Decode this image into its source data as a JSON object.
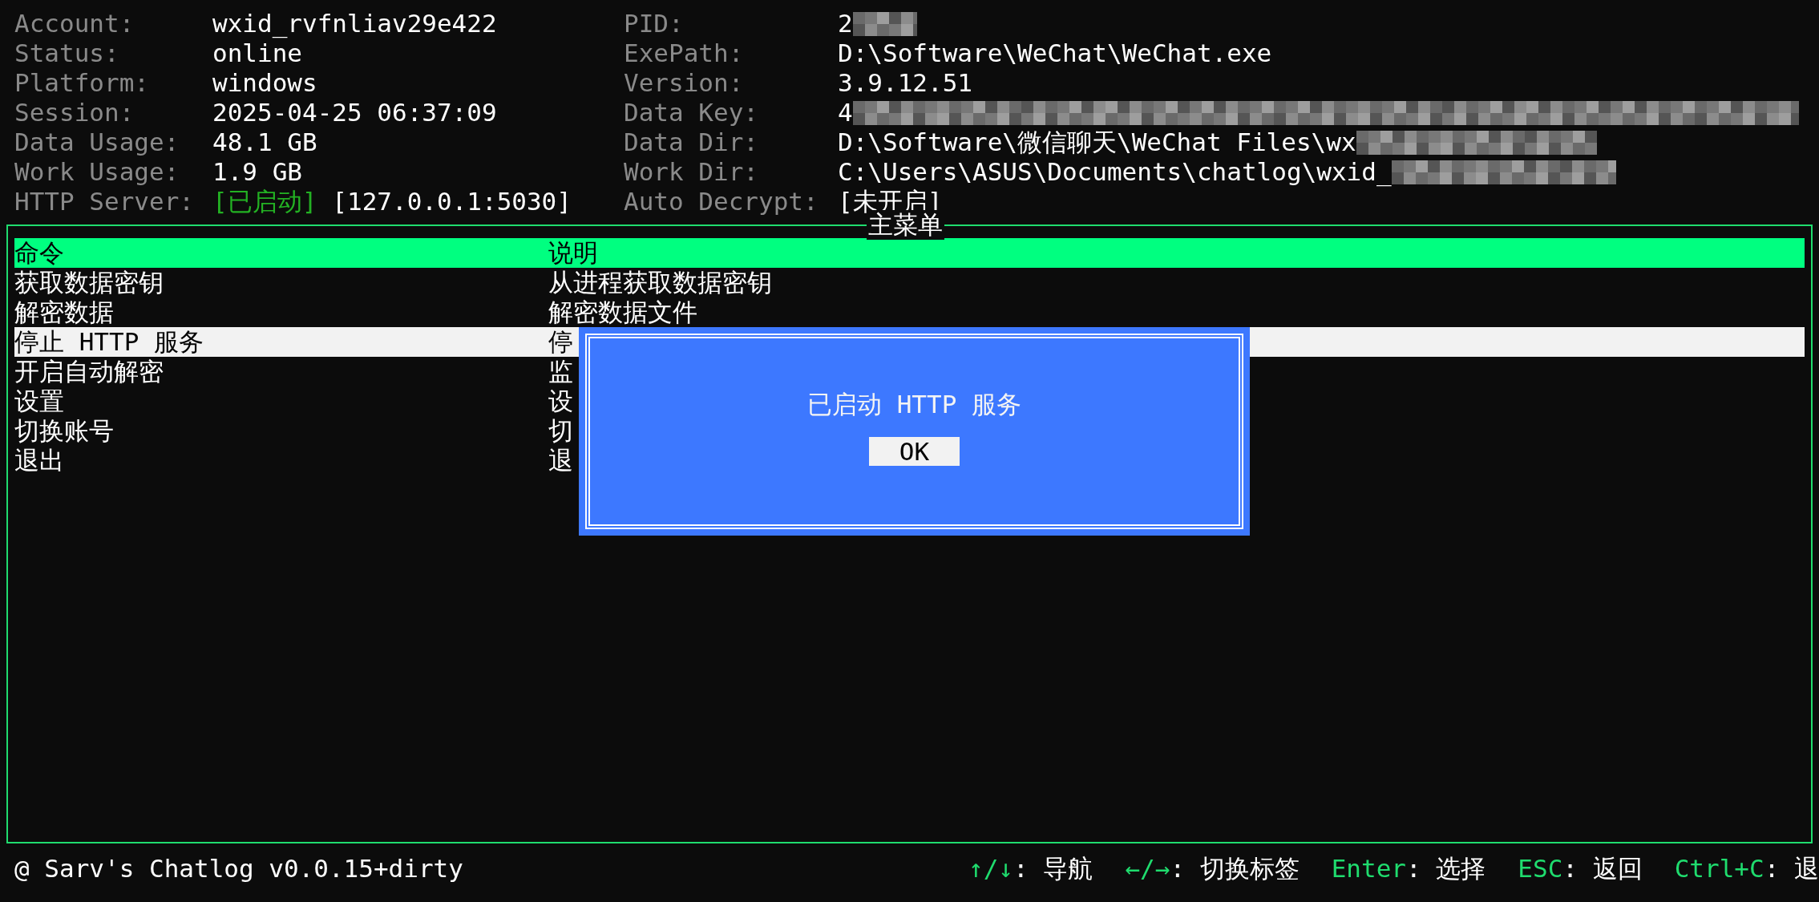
{
  "info_left": [
    {
      "label": "Account:",
      "value": "wxid_rvfnliav29e422"
    },
    {
      "label": "Status:",
      "value": "online"
    },
    {
      "label": "Platform:",
      "value": "windows"
    },
    {
      "label": "Session:",
      "value": "2025-04-25 06:37:09"
    },
    {
      "label": "Data Usage:",
      "value": "48.1 GB"
    },
    {
      "label": "Work Usage:",
      "value": "1.9 GB"
    },
    {
      "label": "HTTP Server:",
      "status": "[已启动]",
      "value": "[127.0.0.1:5030]"
    }
  ],
  "info_right": [
    {
      "label": "PID:",
      "value": "2",
      "redacted": true
    },
    {
      "label": "ExePath:",
      "value": "D:\\Software\\WeChat\\WeChat.exe"
    },
    {
      "label": "Version:",
      "value": "3.9.12.51"
    },
    {
      "label": "Data Key:",
      "value": "4",
      "redacted": true
    },
    {
      "label": "Data Dir:",
      "value": "D:\\Software\\微信聊天\\WeChat Files\\wx",
      "redacted": true
    },
    {
      "label": "Work Dir:",
      "value": "C:\\Users\\ASUS\\Documents\\chatlog\\wxid_",
      "redacted": true
    },
    {
      "label": "Auto Decrypt:",
      "value": "[未开启]"
    }
  ],
  "menu": {
    "title": "主菜单",
    "columns": [
      "命令",
      "说明"
    ],
    "rows": [
      {
        "command": "获取数据密钥",
        "description": "从进程获取数据密钥",
        "selected": false
      },
      {
        "command": "解密数据",
        "description": "解密数据文件",
        "selected": false
      },
      {
        "command": "停止 HTTP 服务",
        "description": "停",
        "selected": true
      },
      {
        "command": "开启自动解密",
        "description": "监",
        "selected": false
      },
      {
        "command": "设置",
        "description": "设",
        "selected": false
      },
      {
        "command": "切换账号",
        "description": "切",
        "selected": false
      },
      {
        "command": "退出",
        "description": "退",
        "selected": false
      }
    ]
  },
  "dialog": {
    "message": "已启动 HTTP 服务",
    "button": "OK"
  },
  "footer": {
    "app": "@ Sarv's Chatlog v0.0.15+dirty",
    "shortcuts": [
      {
        "key": "↑/↓",
        "action": ": 导航"
      },
      {
        "key": "←/→",
        "action": ": 切换标签"
      },
      {
        "key": "Enter",
        "action": ": 选择"
      },
      {
        "key": "ESC",
        "action": ": 返回"
      },
      {
        "key": "Ctrl+C",
        "action": ": 退"
      }
    ]
  }
}
